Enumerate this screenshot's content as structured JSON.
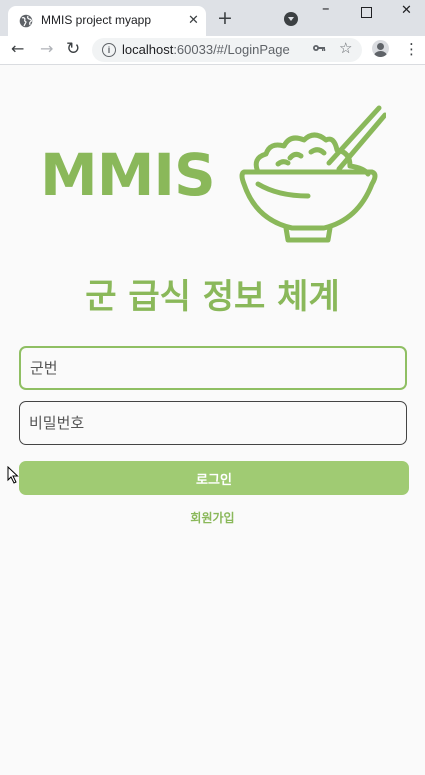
{
  "browser": {
    "tab_title": "MMIS project myapp",
    "tab_close": "✕",
    "new_tab": "+",
    "url_host": "localhost",
    "url_path": ":60033/#/LoginPage"
  },
  "page": {
    "logo_text": "MMIS",
    "heading": "군 급식 정보 체계",
    "id_placeholder": "군번",
    "password_placeholder": "비밀번호",
    "login_button": "로그인",
    "signup_link": "회원가입"
  },
  "colors": {
    "brand_green": "#8ab85a",
    "button_green": "#a0cb73",
    "input_focus_border": "#8fbf63"
  },
  "icons": [
    "globe-icon",
    "close-icon",
    "plus-icon",
    "profile-dropdown-icon",
    "back-arrow-icon",
    "forward-arrow-icon",
    "reload-icon",
    "info-icon",
    "key-icon",
    "star-icon",
    "avatar-icon",
    "kebab-menu-icon",
    "rice-bowl-icon",
    "mouse-cursor-icon"
  ]
}
